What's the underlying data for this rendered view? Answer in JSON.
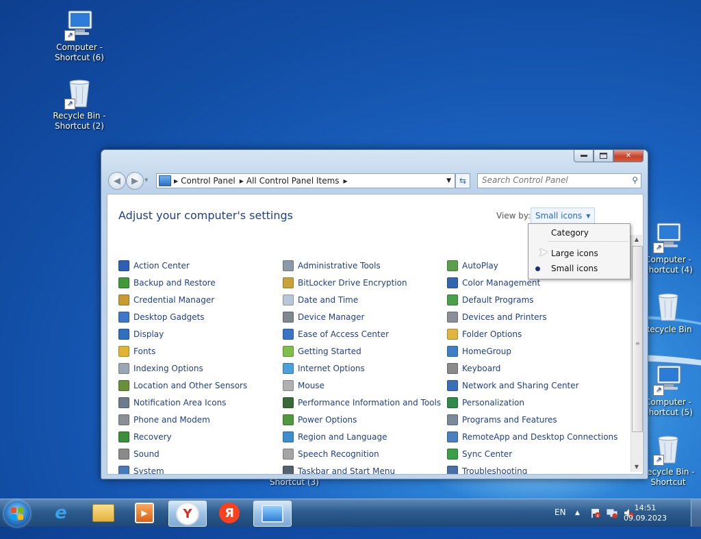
{
  "desktop": {
    "icons": [
      {
        "label": "Computer - Shortcut (6)",
        "icon": "computer-icon"
      },
      {
        "label": "Recycle Bin - Shortcut (2)",
        "icon": "recycle-bin-icon"
      },
      {
        "label": "Computer - Shortcut (4)",
        "icon": "computer-icon"
      },
      {
        "label": "Recycle Bin",
        "icon": "recycle-bin-icon"
      },
      {
        "label": "Computer - Shortcut (5)",
        "icon": "computer-icon"
      },
      {
        "label": "Recycle Bin - Shortcut",
        "icon": "recycle-bin-icon"
      },
      {
        "label": "Shortcut (3)",
        "icon": "shortcut-icon"
      }
    ]
  },
  "window": {
    "breadcrumb": [
      "Control Panel",
      "All Control Panel Items"
    ],
    "search_placeholder": "Search Control Panel",
    "page_title": "Adjust your computer's settings",
    "view_by_label": "View by:",
    "view_by_value": "Small icons",
    "view_menu": {
      "options": [
        "Category",
        "Large icons",
        "Small icons"
      ],
      "selected": "Small icons"
    },
    "items": {
      "col1": [
        {
          "label": "Action Center",
          "color": "#2d5fb5"
        },
        {
          "label": "Backup and Restore",
          "color": "#3f9a3a"
        },
        {
          "label": "Credential Manager",
          "color": "#c89b32"
        },
        {
          "label": "Desktop Gadgets",
          "color": "#3c78c8"
        },
        {
          "label": "Display",
          "color": "#2f6fbf"
        },
        {
          "label": "Fonts",
          "color": "#e0b430"
        },
        {
          "label": "Indexing Options",
          "color": "#9aa6b4"
        },
        {
          "label": "Location and Other Sensors",
          "color": "#6a8f3a"
        },
        {
          "label": "Notification Area Icons",
          "color": "#6d7c8c"
        },
        {
          "label": "Phone and Modem",
          "color": "#8a8f96"
        },
        {
          "label": "Recovery",
          "color": "#3b8f3b"
        },
        {
          "label": "Sound",
          "color": "#8a8a8a"
        },
        {
          "label": "System",
          "color": "#4a79b8"
        }
      ],
      "col2": [
        {
          "label": "Administrative Tools",
          "color": "#8a9aab"
        },
        {
          "label": "BitLocker Drive Encryption",
          "color": "#c9a23a"
        },
        {
          "label": "Date and Time",
          "color": "#b8c7d8"
        },
        {
          "label": "Device Manager",
          "color": "#7f8790"
        },
        {
          "label": "Ease of Access Center",
          "color": "#3a74c4"
        },
        {
          "label": "Getting Started",
          "color": "#7fbf4a"
        },
        {
          "label": "Internet Options",
          "color": "#4aa0d8"
        },
        {
          "label": "Mouse",
          "color": "#b0b0b0"
        },
        {
          "label": "Performance Information and Tools",
          "color": "#3a6a3a"
        },
        {
          "label": "Power Options",
          "color": "#4f9a3c"
        },
        {
          "label": "Region and Language",
          "color": "#3d8ed0"
        },
        {
          "label": "Speech Recognition",
          "color": "#a5a5a5"
        },
        {
          "label": "Taskbar and Start Menu",
          "color": "#56616e"
        }
      ],
      "col3": [
        {
          "label": "AutoPlay",
          "color": "#5aa04a"
        },
        {
          "label": "Color Management",
          "color": "#3266b0"
        },
        {
          "label": "Default Programs",
          "color": "#4aa04a"
        },
        {
          "label": "Devices and Printers",
          "color": "#8a8f98"
        },
        {
          "label": "Folder Options",
          "color": "#e0b640"
        },
        {
          "label": "HomeGroup",
          "color": "#3f7fc8"
        },
        {
          "label": "Keyboard",
          "color": "#8a8a8a"
        },
        {
          "label": "Network and Sharing Center",
          "color": "#3a6fba"
        },
        {
          "label": "Personalization",
          "color": "#2f8a4a"
        },
        {
          "label": "Programs and Features",
          "color": "#7a8a9a"
        },
        {
          "label": "RemoteApp and Desktop Connections",
          "color": "#4a7fc0"
        },
        {
          "label": "Sync Center",
          "color": "#3aa045"
        },
        {
          "label": "Troubleshooting",
          "color": "#4a6fa8"
        }
      ]
    }
  },
  "taskbar": {
    "apps": [
      "Internet Explorer",
      "Windows Explorer",
      "Windows Media Player",
      "Yandex",
      "Yandex Browser",
      "Control Panel"
    ],
    "language": "EN",
    "time": "14:51",
    "date": "09.09.2023"
  }
}
